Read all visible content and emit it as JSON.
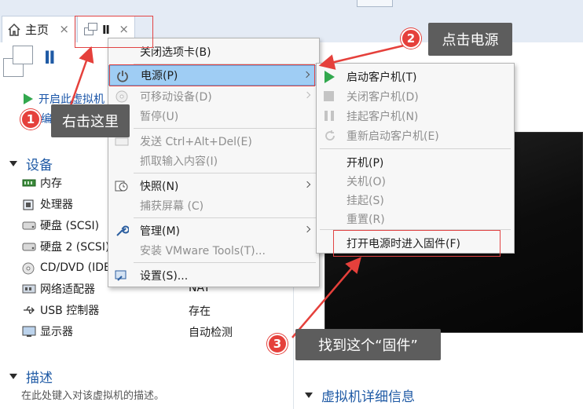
{
  "tabs": [
    {
      "label": "主页",
      "icon": "home-icon",
      "close": "×"
    },
    {
      "label": "Ⅱ",
      "icon": "vm-icon",
      "close": "×"
    }
  ],
  "vm": {
    "title": "Ⅱ"
  },
  "actions": {
    "start": "开启此虚拟机",
    "edit": "编辑"
  },
  "devices": {
    "header": "设备",
    "rows": [
      {
        "name": "内存",
        "icon": "memory-icon",
        "value": ""
      },
      {
        "name": "处理器",
        "icon": "processor-icon",
        "value": ""
      },
      {
        "name": "硬盘 (SCSI)",
        "icon": "harddisk-icon",
        "value": ""
      },
      {
        "name": "硬盘 2 (SCSI)",
        "icon": "harddisk-icon",
        "value": ""
      },
      {
        "name": "CD/DVD (IDE)",
        "icon": "cdrom-icon",
        "value": ""
      },
      {
        "name": "网络适配器",
        "icon": "network-icon",
        "value": "NAT"
      },
      {
        "name": "USB 控制器",
        "icon": "usb-icon",
        "value": "存在"
      },
      {
        "name": "显示器",
        "icon": "display-icon",
        "value": "自动检测"
      }
    ]
  },
  "description": {
    "header": "描述",
    "hint": "在此处键入对该虚拟机的描述。"
  },
  "details": {
    "header": "虚拟机详细信息"
  },
  "context_menu": {
    "close_tab": "关闭选项卡(B)",
    "power": "电源(P)",
    "removable": "可移动设备(D)",
    "pause": "暂停(U)",
    "send_cad": "发送 Ctrl+Alt+Del(E)",
    "grab_input": "抓取输入内容(I)",
    "snapshot": "快照(N)",
    "capture_screen": "捕获屏幕 (C)",
    "manage": "管理(M)",
    "install_tools": "安装 VMware Tools(T)...",
    "settings": "设置(S)..."
  },
  "power_submenu": {
    "start_guest": "启动客户机(T)",
    "shutdown_guest": "关闭客户机(D)",
    "suspend_guest": "挂起客户机(N)",
    "restart_guest": "重新启动客户机(E)",
    "power_on": "开机(P)",
    "power_off": "关机(O)",
    "suspend": "挂起(S)",
    "reset": "重置(R)",
    "firmware": "打开电源时进入固件(F)"
  },
  "annotations": {
    "step1": {
      "num": "1",
      "text": "右击这里"
    },
    "step2": {
      "num": "2",
      "text": "点击电源"
    },
    "step3": {
      "num": "3",
      "text": "找到这个“固件”"
    }
  },
  "colors": {
    "accent": "#1f5aa5",
    "highlight": "#9fcdf4",
    "annotation_red": "#e5403b",
    "callout_bg": "#5d5d5d",
    "play_green": "#32a84e"
  }
}
